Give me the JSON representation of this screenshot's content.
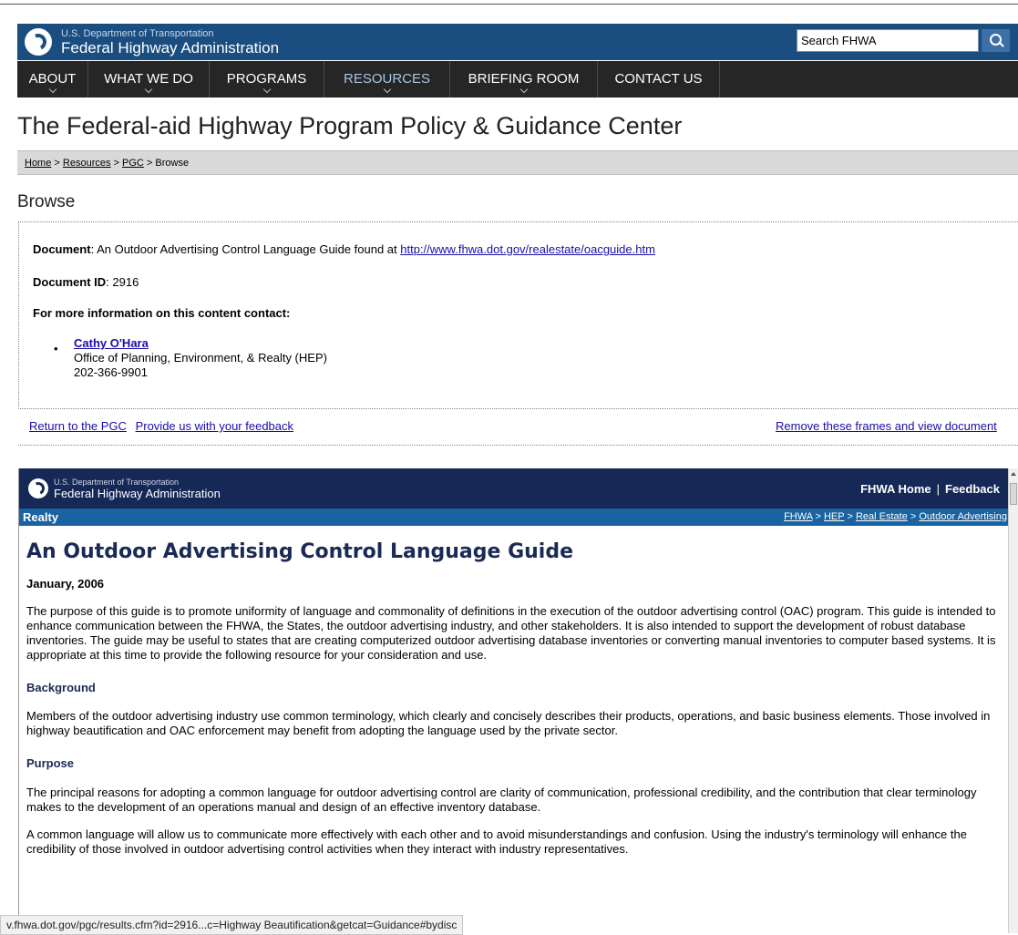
{
  "header": {
    "dept": "U.S. Department of Transportation",
    "agency": "Federal Highway Administration",
    "search_placeholder": "Search FHWA"
  },
  "nav": [
    "ABOUT",
    "WHAT WE DO",
    "PROGRAMS",
    "RESOURCES",
    "BRIEFING ROOM",
    "CONTACT US"
  ],
  "nav_active": "RESOURCES",
  "page_title": "The Federal-aid Highway Program Policy & Guidance Center",
  "breadcrumb": {
    "home": "Home",
    "resources": "Resources",
    "pgc": "PGC",
    "current": "Browse",
    "sep": " > "
  },
  "browse_title": "Browse",
  "info": {
    "document_label": "Document",
    "document_text": ": An Outdoor Advertising Control Language Guide found at ",
    "document_url": "http://www.fhwa.dot.gov/realestate/oacguide.htm",
    "docid_label": "Document ID",
    "docid_value": ": 2916",
    "contact_heading": "For more information on this content contact:",
    "contact_name": "Cathy O'Hara",
    "contact_office": "Office of Planning, Environment, & Realty (HEP)",
    "contact_phone": "202-366-9901"
  },
  "links": {
    "return": "Return to the PGC",
    "feedback": "Provide us with your feedback",
    "remove_frames": "Remove these frames and view document"
  },
  "frame": {
    "dept": "U.S. Department of Transportation",
    "agency": "Federal Highway Administration",
    "home_link": "FHWA Home",
    "feedback_link": "Feedback",
    "section": "Realty",
    "crumbs": [
      "FHWA",
      "HEP",
      "Real Estate",
      "Outdoor Advertising"
    ],
    "title": "An Outdoor Advertising Control Language Guide",
    "date": "January, 2006",
    "intro": "The purpose of this guide is to promote uniformity of language and commonality of definitions in the execution of the outdoor advertising control (OAC) program. This guide is intended to enhance communication between the FHWA, the States, the outdoor advertising industry, and other stakeholders. It is also intended to support the development of robust database inventories. The guide may be useful to states that are creating computerized outdoor advertising database inventories or converting manual inventories to computer based systems. It is appropriate at this time to provide the following resource for your consideration and use.",
    "background_heading": "Background",
    "background_text": "Members of the outdoor advertising industry use common terminology, which clearly and concisely describes their products, operations, and basic business elements. Those involved in highway beautification and OAC enforcement may benefit from adopting the language used by the private sector.",
    "purpose_heading": "Purpose",
    "purpose_text_1": "The principal reasons for adopting a common language for outdoor advertising control are clarity of communication, professional credibility, and the contribution that clear terminology makes to the development of an operations manual and design of an effective inventory database.",
    "purpose_text_2": "A common language will allow us to communicate more effectively with each other and to avoid misunderstandings and confusion. Using the industry's terminology will enhance the credibility of those involved in outdoor advertising control activities when they interact with industry representatives."
  },
  "status_url": "v.fhwa.dot.gov/pgc/results.cfm?id=2916...c=Highway Beautification&getcat=Guidance#bydisc"
}
